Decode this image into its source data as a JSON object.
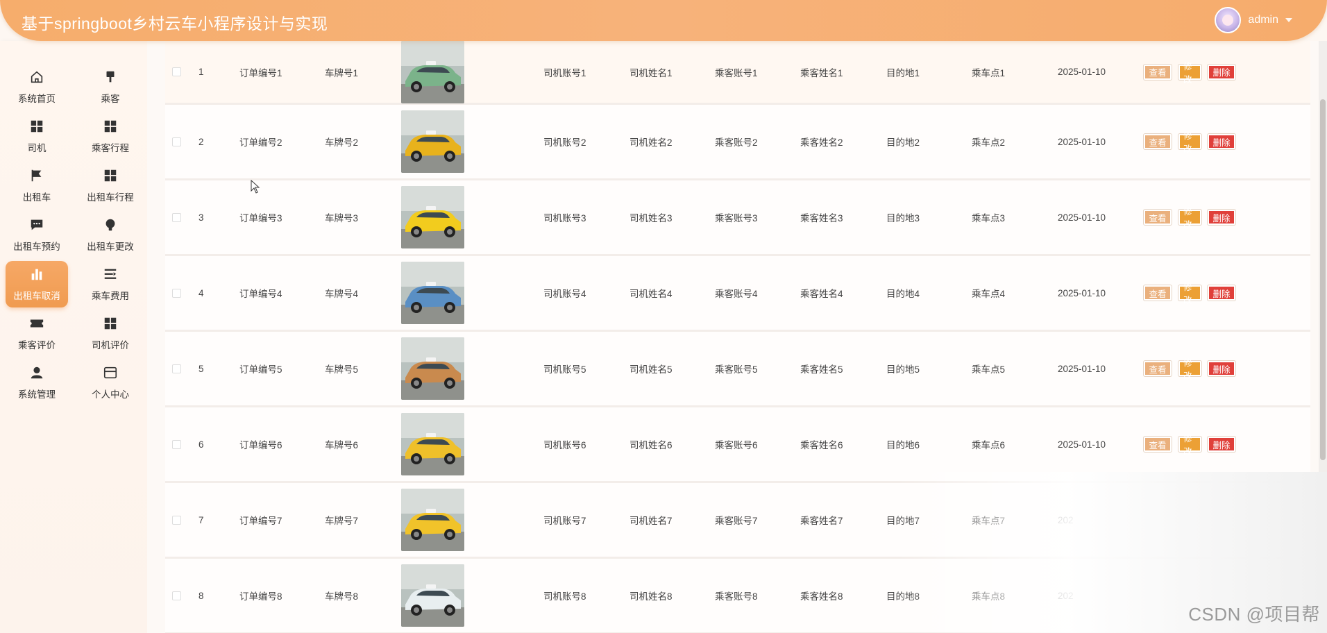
{
  "header": {
    "title": "基于springboot乡村云车小程序设计与实现",
    "user": "admin"
  },
  "sidebar": {
    "items": [
      {
        "label": "系统首页",
        "icon": "home-icon"
      },
      {
        "label": "乘客",
        "icon": "brush-icon"
      },
      {
        "label": "司机",
        "icon": "grid-icon"
      },
      {
        "label": "乘客行程",
        "icon": "grid-icon"
      },
      {
        "label": "出租车",
        "icon": "flag-icon"
      },
      {
        "label": "出租车行程",
        "icon": "grid-icon"
      },
      {
        "label": "出租车预约",
        "icon": "chat-icon"
      },
      {
        "label": "出租车更改",
        "icon": "bulb-icon"
      },
      {
        "label": "出租车取消",
        "icon": "bar-chart-icon",
        "active": true
      },
      {
        "label": "乘车费用",
        "icon": "list-icon"
      },
      {
        "label": "乘客评价",
        "icon": "ticket-icon"
      },
      {
        "label": "司机评价",
        "icon": "grid-icon"
      },
      {
        "label": "系统管理",
        "icon": "user-icon"
      },
      {
        "label": "个人中心",
        "icon": "card-icon"
      }
    ]
  },
  "table": {
    "buttons": {
      "view": "查看",
      "edit": "修改",
      "delete": "删除"
    },
    "rows": [
      {
        "idx": "1",
        "order": "订单编号1",
        "plate": "车牌号1",
        "driver_acct": "司机账号1",
        "driver_name": "司机姓名1",
        "pass_acct": "乘客账号1",
        "pass_name": "乘客姓名1",
        "dest": "目的地1",
        "pickup": "乘车点1",
        "date": "2025-01-10",
        "car_color": "#7bb38a"
      },
      {
        "idx": "2",
        "order": "订单编号2",
        "plate": "车牌号2",
        "driver_acct": "司机账号2",
        "driver_name": "司机姓名2",
        "pass_acct": "乘客账号2",
        "pass_name": "乘客姓名2",
        "dest": "目的地2",
        "pickup": "乘车点2",
        "date": "2025-01-10",
        "car_color": "#e8b21c"
      },
      {
        "idx": "3",
        "order": "订单编号3",
        "plate": "车牌号3",
        "driver_acct": "司机账号3",
        "driver_name": "司机姓名3",
        "pass_acct": "乘客账号3",
        "pass_name": "乘客姓名3",
        "dest": "目的地3",
        "pickup": "乘车点3",
        "date": "2025-01-10",
        "car_color": "#f2cc1e"
      },
      {
        "idx": "4",
        "order": "订单编号4",
        "plate": "车牌号4",
        "driver_acct": "司机账号4",
        "driver_name": "司机姓名4",
        "pass_acct": "乘客账号4",
        "pass_name": "乘客姓名4",
        "dest": "目的地4",
        "pickup": "乘车点4",
        "date": "2025-01-10",
        "car_color": "#5a8fc4"
      },
      {
        "idx": "5",
        "order": "订单编号5",
        "plate": "车牌号5",
        "driver_acct": "司机账号5",
        "driver_name": "司机姓名5",
        "pass_acct": "乘客账号5",
        "pass_name": "乘客姓名5",
        "dest": "目的地5",
        "pickup": "乘车点5",
        "date": "2025-01-10",
        "car_color": "#c98a4e"
      },
      {
        "idx": "6",
        "order": "订单编号6",
        "plate": "车牌号6",
        "driver_acct": "司机账号6",
        "driver_name": "司机姓名6",
        "pass_acct": "乘客账号6",
        "pass_name": "乘客姓名6",
        "dest": "目的地6",
        "pickup": "乘车点6",
        "date": "2025-01-10",
        "car_color": "#efc02a"
      },
      {
        "idx": "7",
        "order": "订单编号7",
        "plate": "车牌号7",
        "driver_acct": "司机账号7",
        "driver_name": "司机姓名7",
        "pass_acct": "乘客账号7",
        "pass_name": "乘客姓名7",
        "dest": "目的地7",
        "pickup": "乘车点7",
        "date": "202",
        "car_color": "#f1c32a"
      },
      {
        "idx": "8",
        "order": "订单编号8",
        "plate": "车牌号8",
        "driver_acct": "司机账号8",
        "driver_name": "司机姓名8",
        "pass_acct": "乘客账号8",
        "pass_name": "乘客姓名8",
        "dest": "目的地8",
        "pickup": "乘车点8",
        "date": "202",
        "car_color": "#e8eef0"
      }
    ]
  },
  "watermark": "CSDN @项目帮"
}
